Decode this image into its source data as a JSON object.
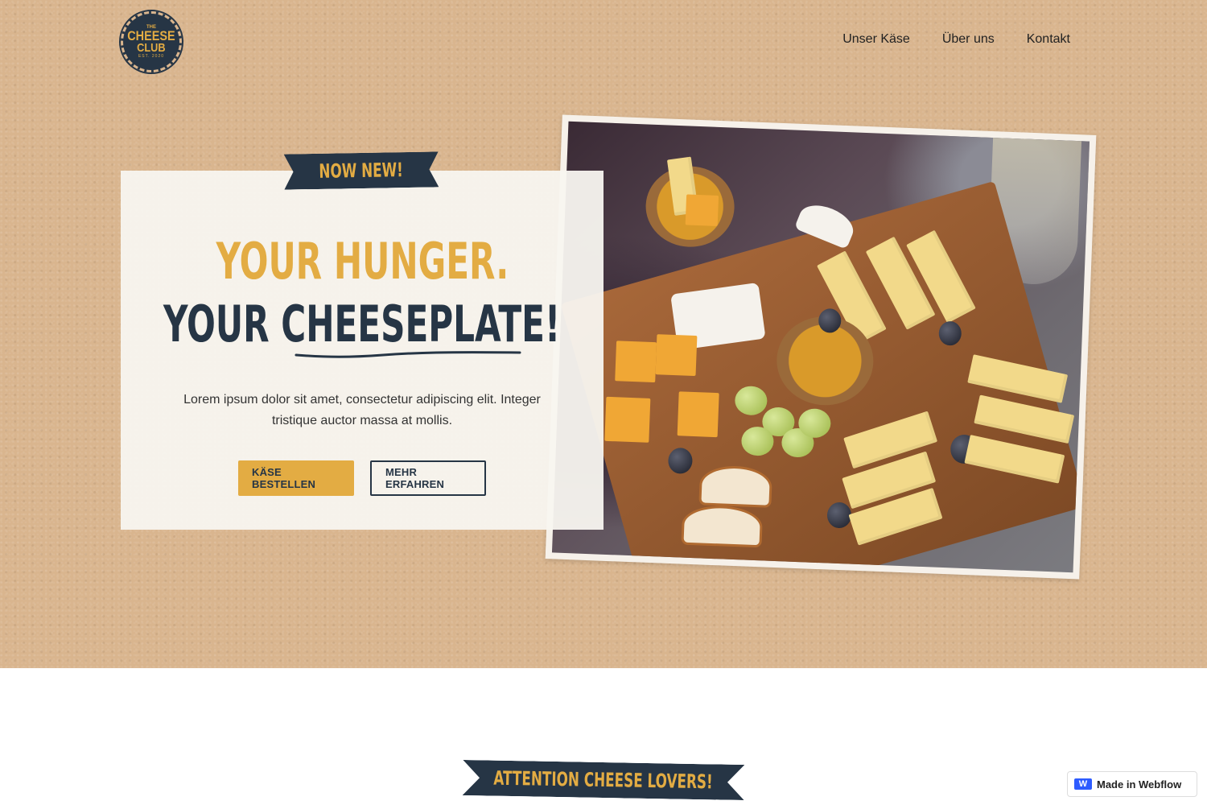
{
  "logo": {
    "top": "THE",
    "line1": "CHEESE",
    "line2": "CLUB",
    "bottom": "EST. 2020"
  },
  "nav": {
    "items": [
      "Unser Käse",
      "Über uns",
      "Kontakt"
    ]
  },
  "hero": {
    "ribbon": "Now new!",
    "headline_1": "Your hunger.",
    "headline_2": "Your cheeseplate!",
    "lede": "Lorem ipsum dolor sit amet, consectetur adipiscing elit. Integer tristique auctor massa at mollis.",
    "primary_button": "KÄSE BESTELLEN",
    "secondary_button": "MEHR ERFAHREN"
  },
  "section2": {
    "ribbon": "Attention cheese lovers!"
  },
  "badge": {
    "label": "Made in Webflow"
  },
  "colors": {
    "navy": "#263545",
    "mustard": "#e3ac43",
    "kraft": "#d9b58e"
  }
}
